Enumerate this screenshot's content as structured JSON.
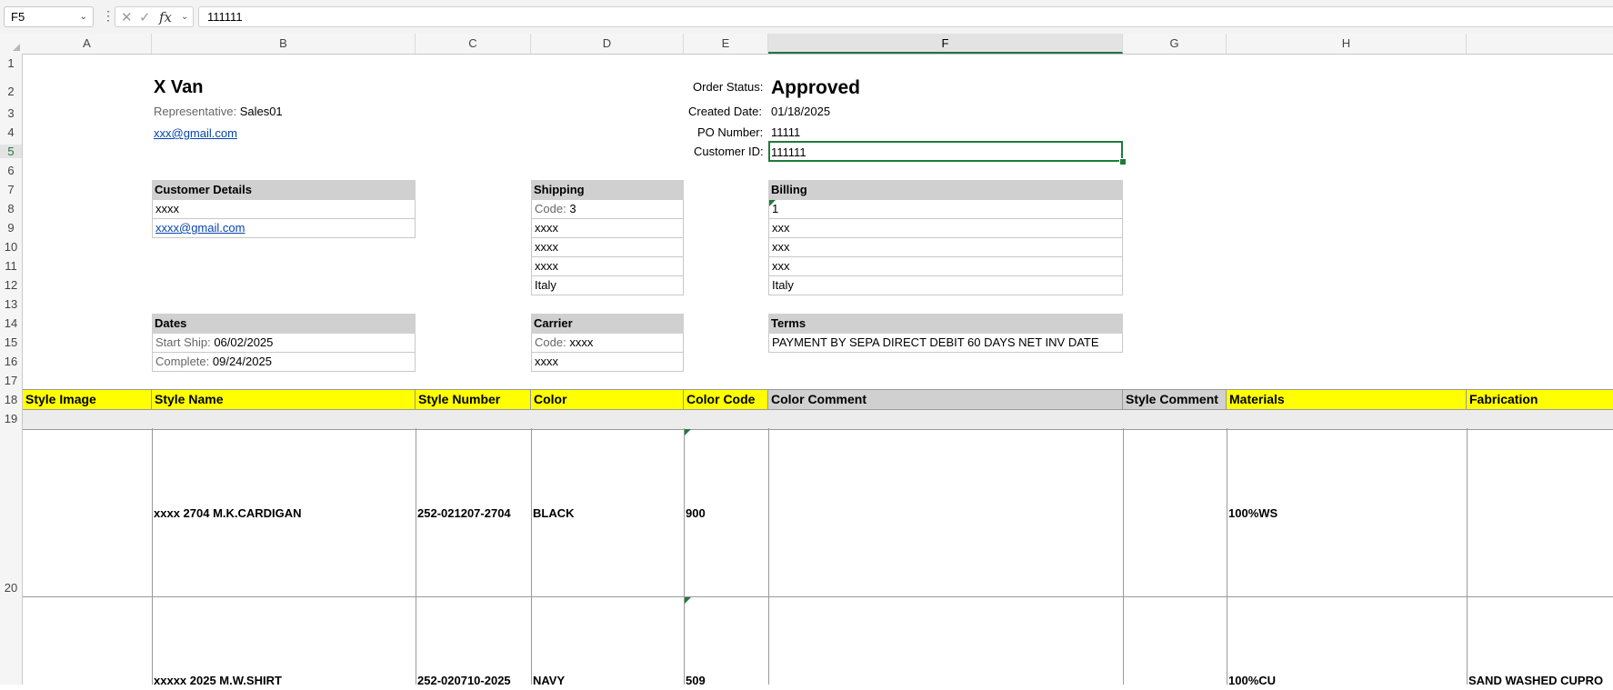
{
  "formula_bar": {
    "name_box": "F5",
    "formula_value": "111111"
  },
  "columns": [
    "A",
    "B",
    "C",
    "D",
    "E",
    "F",
    "G",
    "H"
  ],
  "rows": [
    "1",
    "2",
    "3",
    "4",
    "5",
    "6",
    "7",
    "8",
    "9",
    "10",
    "11",
    "12",
    "13",
    "14",
    "15",
    "16",
    "17",
    "18",
    "19",
    "20"
  ],
  "header": {
    "company": "X Van",
    "rep_label": "Representative:",
    "rep_value": "Sales01",
    "email": "xxx@gmail.com",
    "order_status_label": "Order Status:",
    "order_status_value": "Approved",
    "created_date_label": "Created Date:",
    "created_date_value": "01/18/2025",
    "po_label": "PO Number:",
    "po_value": "11111",
    "customer_id_label": "Customer ID:",
    "customer_id_value": "111111"
  },
  "customer_details": {
    "title": "Customer Details",
    "name": "xxxx",
    "email": "xxxx@gmail.com"
  },
  "shipping": {
    "title": "Shipping",
    "code_label": "Code:",
    "code_value": "3",
    "lines": [
      "xxxx",
      "xxxx",
      "xxxx",
      "Italy"
    ]
  },
  "billing": {
    "title": "Billing",
    "lines": [
      "1",
      "xxx",
      "xxx",
      "xxx",
      "Italy"
    ]
  },
  "dates": {
    "title": "Dates",
    "start_label": "Start Ship:",
    "start_value": "06/02/2025",
    "complete_label": "Complete:",
    "complete_value": "09/24/2025"
  },
  "carrier": {
    "title": "Carrier",
    "code_label": "Code:",
    "code_value": "xxxx",
    "line": "xxxx"
  },
  "terms": {
    "title": "Terms",
    "value": "PAYMENT BY SEPA DIRECT DEBIT 60 DAYS NET INV DATE"
  },
  "table": {
    "headers": [
      "Style Image",
      "Style Name",
      "Style Number",
      "Color",
      "Color Code",
      "Color Comment",
      "Style Comment",
      "Materials",
      "Fabrication"
    ],
    "rows": [
      [
        "",
        "xxxx 2704 M.K.CARDIGAN",
        "252-021207-2704",
        "BLACK",
        "900",
        "",
        "",
        "100%WS",
        ""
      ],
      [
        "",
        "xxxxx 2025 M.W.SHIRT",
        "252-020710-2025",
        "NAVY",
        "509",
        "",
        "",
        "100%CU",
        "SAND WASHED CUPRO"
      ]
    ]
  }
}
